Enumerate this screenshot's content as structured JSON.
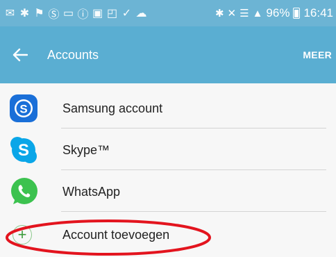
{
  "status_bar": {
    "battery": "96%",
    "time": "16:41"
  },
  "toolbar": {
    "title": "Accounts",
    "more_label": "MEER"
  },
  "accounts": [
    {
      "label": "Samsung account",
      "icon": "samsung-account-icon",
      "color": "#1a73d9"
    },
    {
      "label": "Skype™",
      "icon": "skype-icon",
      "color": "#0aa6e8"
    },
    {
      "label": "WhatsApp",
      "icon": "whatsapp-icon",
      "color": "#3cc24f"
    }
  ],
  "add_account": {
    "label": "Account toevoegen",
    "icon": "plus-icon"
  },
  "colors": {
    "status_bar": "#6cb4d4",
    "toolbar": "#5aaed2",
    "highlight_ring": "#e3141e"
  }
}
